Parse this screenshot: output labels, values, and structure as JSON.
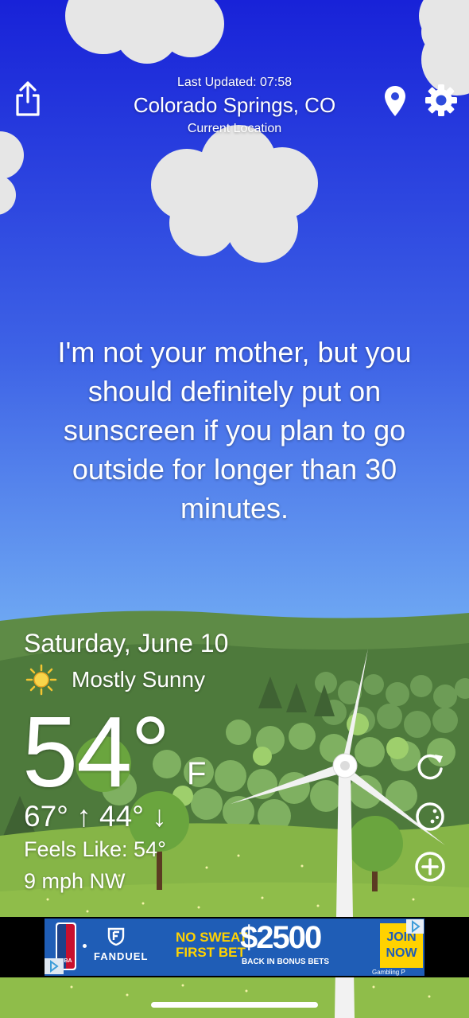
{
  "header": {
    "last_updated": "Last Updated: 07:58",
    "location": "Colorado Springs, CO",
    "location_sub": "Current Location"
  },
  "message": "I'm not your mother, but you should definitely put on sunscreen if you plan to go outside for longer than 30 minutes.",
  "weather": {
    "date": "Saturday, June 10",
    "condition": "Mostly Sunny",
    "condition_icon": "sun-icon",
    "temperature": "54°",
    "unit": "F",
    "hi_lo": "67° ↑  44° ↓",
    "feels_like": "Feels Like: 54°",
    "wind": "9 mph NW"
  },
  "ad": {
    "nba": "NBA",
    "brand": "FANDUEL",
    "headline_1": "NO SWEAT",
    "headline_2": "FIRST BET",
    "amount": "$2500",
    "sub": "BACK IN BONUS BETS",
    "cta_1": "JOIN",
    "cta_2": "NOW",
    "footnote": "Gambling P"
  },
  "colors": {
    "sky_top": "#1a2bd6",
    "sky_bottom": "#6fa9f3",
    "hills": "#5a8c3e",
    "meadow": "#8cbb48",
    "ad_blue": "#1f5db6",
    "ad_yellow": "#ffd200"
  }
}
